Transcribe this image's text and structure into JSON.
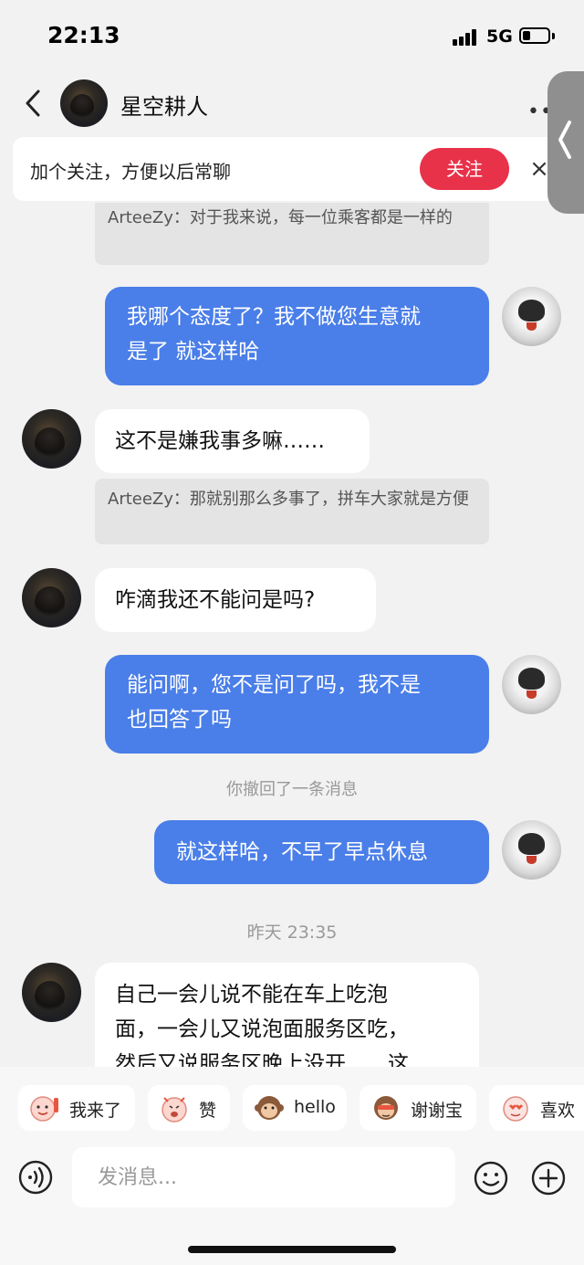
{
  "status_bar": {
    "time": "22:13",
    "network": "5G",
    "battery_level": 0.3
  },
  "header": {
    "contact_name": "星空耕人"
  },
  "follow_banner": {
    "text": "加个关注，方便以后常聊",
    "button_label": "关注",
    "close_symbol": "×"
  },
  "messages": {
    "quote_1": "ArteeZy：对于我来说，每一位乘客都是一样的",
    "out_1_line1": "我哪个态度了？我不做您生意就",
    "out_1_line2": "是了 就这样哈",
    "in_1": "这不是嫌我事多嘛……",
    "quote_2": "ArteeZy：那就别那么多事了，拼车大家就是方便",
    "in_2": "咋滴我还不能问是吗?",
    "out_2_line1": "能问啊，您不是问了吗，我不是",
    "out_2_line2": "也回答了吗",
    "recall_note": "你撤回了一条消息",
    "out_3": "就这样哈，不早了早点休息",
    "time_divider": "昨天 23:35",
    "in_3_line1": "自己一会儿说不能在车上吃泡",
    "in_3_line2": "面，一会儿又说泡面服务区吃，",
    "in_3_line3": "然后又说服务区晚上没开……这"
  },
  "quick_replies": [
    {
      "label": "我来了",
      "icon": "waving-emoji-icon"
    },
    {
      "label": "赞",
      "icon": "thumbs-emoji-icon"
    },
    {
      "label": "hello",
      "icon": "monkey-emoji-icon"
    },
    {
      "label": "谢谢宝",
      "icon": "monkey-thanks-emoji-icon"
    },
    {
      "label": "喜欢",
      "icon": "love-emoji-icon"
    }
  ],
  "composer": {
    "placeholder": "发消息..."
  },
  "colors": {
    "accent_blue": "#4a7ee8",
    "follow_red": "#e8324a",
    "background": "#f2f2f2"
  }
}
